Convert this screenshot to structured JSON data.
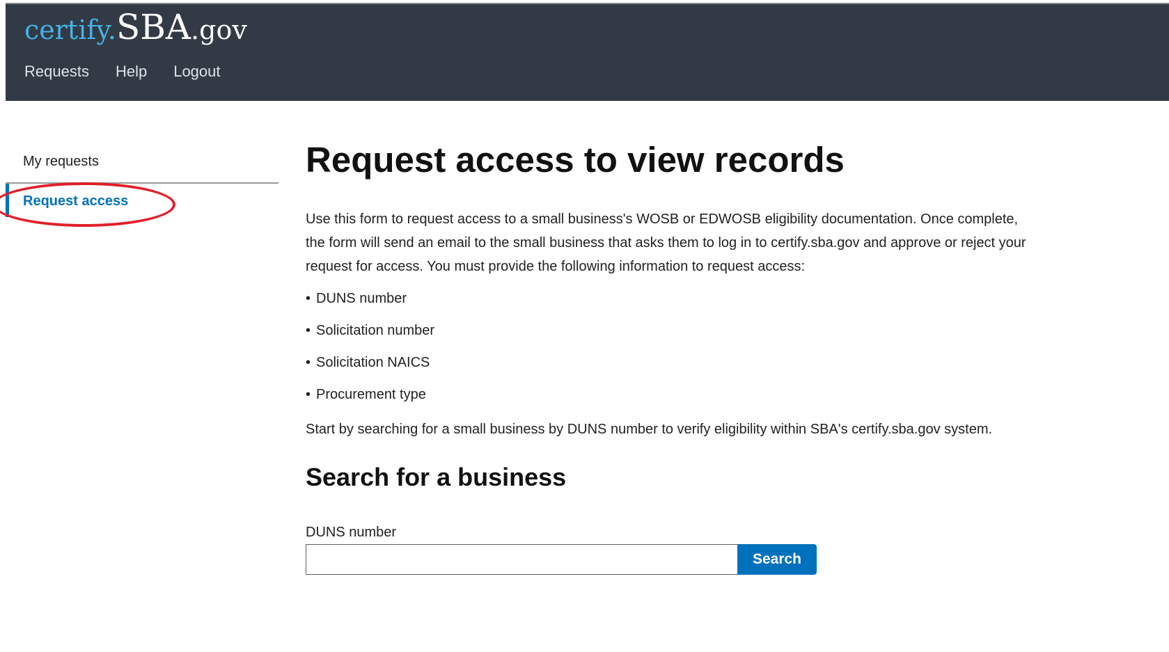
{
  "header": {
    "logo": {
      "part1": "certify.",
      "part2": "SBA",
      "part3": ".gov"
    },
    "nav": [
      {
        "label": "Requests"
      },
      {
        "label": "Help"
      },
      {
        "label": "Logout"
      }
    ]
  },
  "sidebar": {
    "items": [
      {
        "label": "My requests",
        "active": false
      },
      {
        "label": "Request access",
        "active": true
      }
    ]
  },
  "main": {
    "title": "Request access to view records",
    "intro": "Use this form to request access to a small business's WOSB or EDWOSB eligibility documentation. Once complete, the form will send an email to the small business that asks them to log in to certify.sba.gov and approve or reject your request for access. You must provide the following information to request access:",
    "requirements": [
      "DUNS number",
      "Solicitation number",
      "Solicitation NAICS",
      "Procurement type"
    ],
    "start_text": "Start by searching for a small business by DUNS number to verify eligibility within SBA's certify.sba.gov system.",
    "search_section": {
      "title": "Search for a business",
      "field_label": "DUNS number",
      "input_value": "",
      "button_label": "Search"
    }
  },
  "colors": {
    "header_bg": "#323a45",
    "logo_accent": "#46b2e6",
    "primary_blue": "#0071bc",
    "annotation_red": "#e0202a"
  }
}
